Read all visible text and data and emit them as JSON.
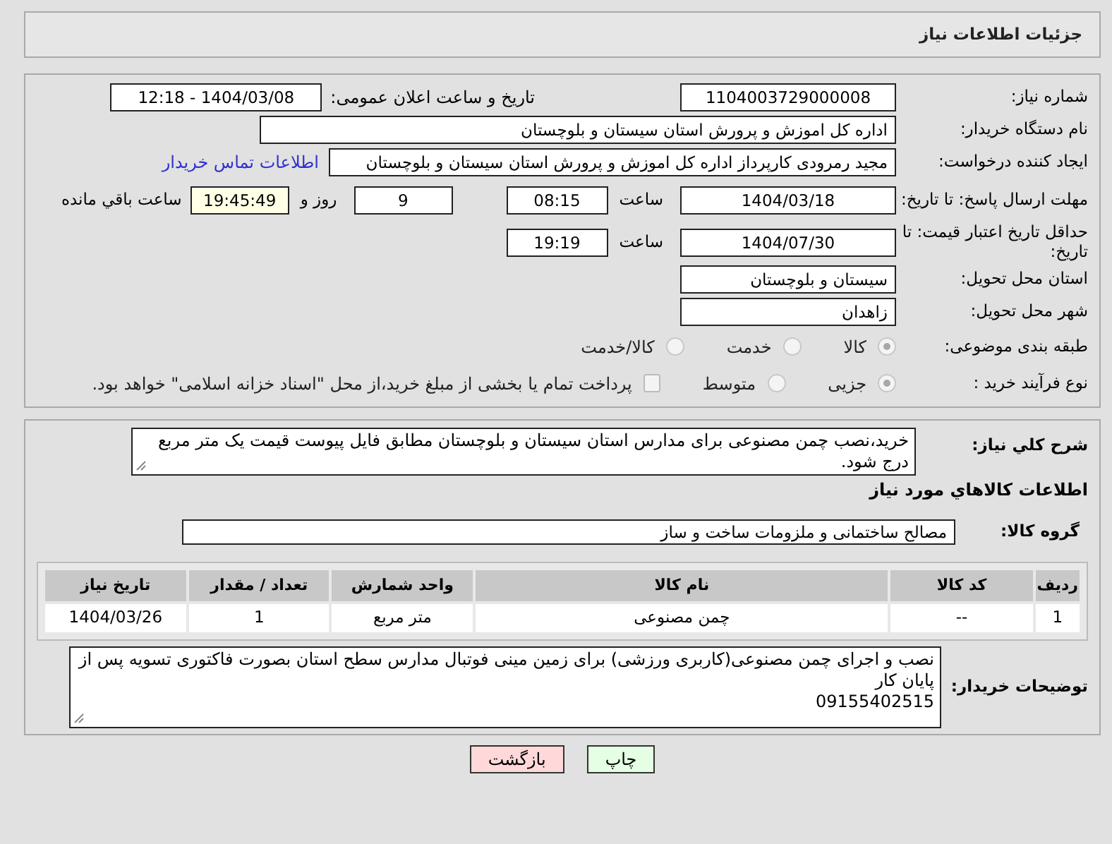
{
  "header": {
    "title": "جزئیات اطلاعات نیاز"
  },
  "need_number": {
    "label": "شماره نیاز:",
    "value": "1104003729000008"
  },
  "announce": {
    "label": "تاریخ و ساعت اعلان عمومی:",
    "value": "1404/03/08 - 12:18"
  },
  "buyer_org": {
    "label": "نام دستگاه خریدار:",
    "value": "اداره کل اموزش و پرورش استان سیستان و بلوچستان"
  },
  "requester": {
    "label": "ایجاد کننده درخواست:",
    "value": "مجید رمرودی کارپرداز اداره کل اموزش و پرورش استان سیستان و بلوچستان",
    "link": "اطلاعات تماس خریدار"
  },
  "reply_deadline": {
    "label": "مهلت ارسال پاسخ: تا تاریخ:",
    "date": "1404/03/18",
    "time_label": "ساعت",
    "time": "08:15",
    "days": "9",
    "days_label": "روز و",
    "remaining": "19:45:49",
    "remaining_label": "ساعت باقي مانده"
  },
  "price_validity": {
    "label": "حداقل تاریخ اعتبار قیمت: تا تاریخ:",
    "date": "1404/07/30",
    "time_label": "ساعت",
    "time": "19:19"
  },
  "delivery_province": {
    "label": "استان محل تحویل:",
    "value": "سیستان و بلوچستان"
  },
  "delivery_city": {
    "label": "شهر محل تحویل:",
    "value": "زاهدان"
  },
  "category": {
    "label": "طبقه بندی موضوعی:",
    "options": [
      {
        "label": "کالا",
        "selected": true
      },
      {
        "label": "خدمت",
        "selected": false
      },
      {
        "label": "کالا/خدمت",
        "selected": false
      }
    ]
  },
  "purchase_type": {
    "label": "نوع فرآیند خرید :",
    "options": [
      {
        "label": "جزیی",
        "selected": true
      },
      {
        "label": "متوسط",
        "selected": false
      }
    ],
    "treasury": {
      "label": "پرداخت تمام یا بخشی از مبلغ خرید،از محل \"اسناد خزانه اسلامی\" خواهد بود.",
      "checked": false
    }
  },
  "description": {
    "label": "شرح کلي نیاز:",
    "value": "خرید،نصب چمن مصنوعی برای مدارس استان سیستان و بلوچستان مطابق فایل پیوست قیمت یک متر مربع درج شود."
  },
  "items_title": "اطلاعات کالاهاي مورد نیاز",
  "goods_group": {
    "label": "گروه کالا:",
    "value": "مصالح ساختمانی و ملزومات ساخت و ساز"
  },
  "table": {
    "columns": [
      "ردیف",
      "کد کالا",
      "نام کالا",
      "واحد شمارش",
      "تعداد / مقدار",
      "تاریخ نیاز"
    ],
    "rows": [
      [
        "1",
        "--",
        "چمن مصنوعی",
        "متر مربع",
        "1",
        "1404/03/26"
      ]
    ]
  },
  "buyer_notes": {
    "label": "توضیحات خریدار:",
    "value": "نصب و اجرای چمن مصنوعی(کاربری ورزشی) برای زمین مینی فوتبال مدارس سطح استان بصورت فاکتوری تسویه پس از پایان کار\n09155402515"
  },
  "buttons": [
    {
      "label": "چاپ",
      "kind": "print"
    },
    {
      "label": "بازگشت",
      "kind": "back"
    }
  ]
}
